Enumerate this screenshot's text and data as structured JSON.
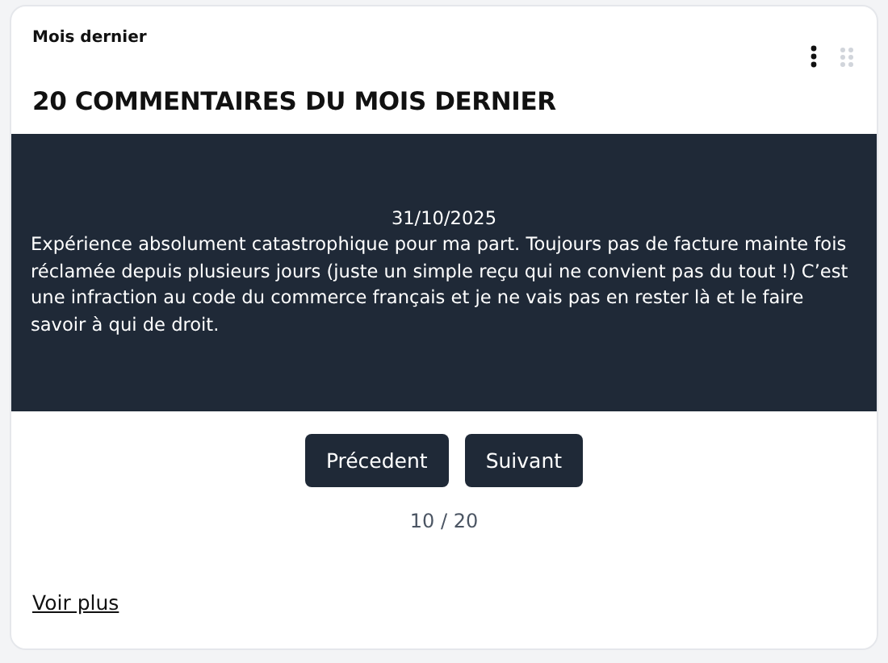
{
  "card": {
    "subtitle": "Mois dernier",
    "title": "20 COMMENTAIRES DU MOIS DERNIER"
  },
  "comment": {
    "date": "31/10/2025",
    "text": "Expérience absolument catastrophique pour ma part. Toujours pas de facture mainte fois réclamée depuis plusieurs jours (juste un simple reçu qui ne convient pas du tout !) C’est une infraction au code du commerce français et je ne vais pas en rester là et le faire savoir à qui de droit."
  },
  "buttons": [
    "Précedent",
    "Suivant"
  ],
  "pager": "10 / 20",
  "more_link": "Voir plus"
}
